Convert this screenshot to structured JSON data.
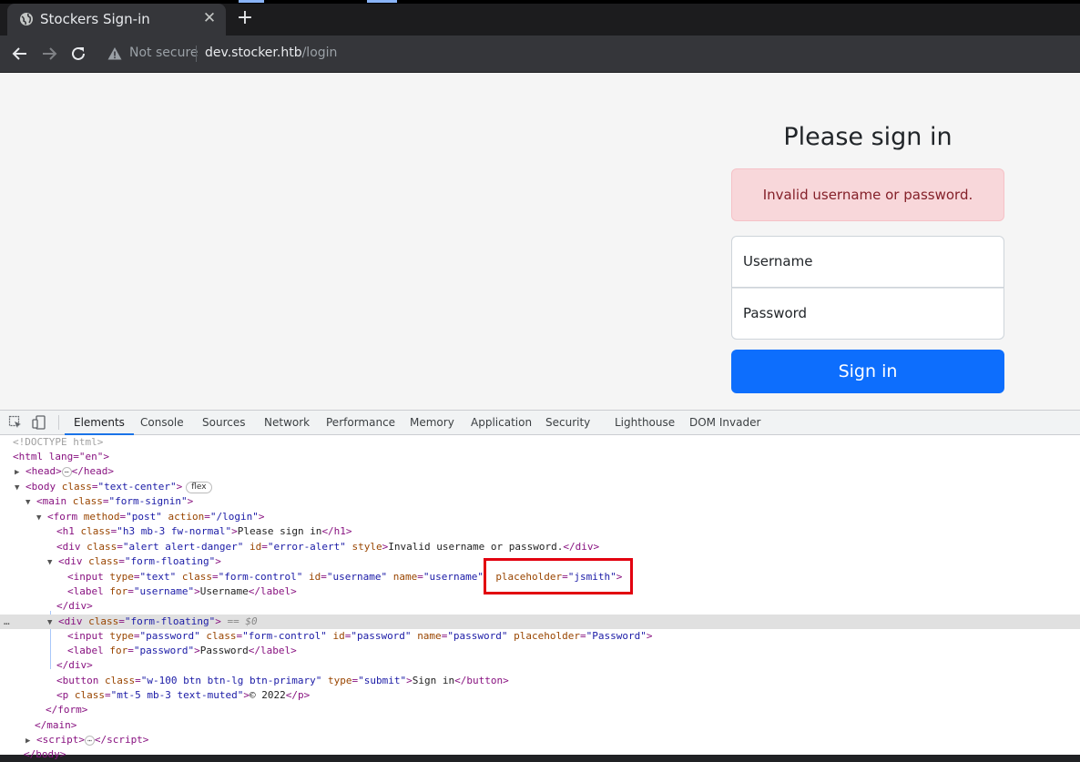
{
  "browser": {
    "tab_title": "Stockers Sign-in",
    "omnibox": {
      "security_label": "Not secure",
      "host": "dev.stocker.htb",
      "path": "/login"
    },
    "icons": [
      "globe-icon",
      "close-icon",
      "plus-icon",
      "back-arrow-icon",
      "forward-arrow-icon",
      "reload-icon",
      "warning-icon"
    ]
  },
  "page": {
    "heading": "Please sign in",
    "alert": "Invalid username or password.",
    "username_label": "Username",
    "password_label": "Password",
    "submit_label": "Sign in"
  },
  "devtools": {
    "tabs": [
      "Elements",
      "Console",
      "Sources",
      "Network",
      "Performance",
      "Memory",
      "Application",
      "Security",
      "Lighthouse",
      "DOM Invader"
    ],
    "active_tab": "Elements",
    "dom": {
      "doctype": "<!DOCTYPE html>",
      "html_open": "<html lang=\"en\">",
      "head_open": "<head>",
      "head_close": "</head>",
      "body_tag": "body",
      "body_class_attr": "class",
      "body_class_val": "\"text-center\"",
      "body_badge": "flex",
      "main_tag": "main",
      "main_class_val": "\"form-signin\"",
      "form_tag": "form",
      "form_method_val": "\"post\"",
      "form_action_val": "\"/login\"",
      "h1_tag": "h1",
      "h1_class_val": "\"h3 mb-3 fw-normal\"",
      "h1_text": "Please sign in",
      "alert_tag": "div",
      "alert_class_val": "\"alert alert-danger\"",
      "alert_id_val": "\"error-alert\"",
      "alert_style_attr": "style",
      "alert_text": "Invalid username or password.",
      "ff_class_val": "\"form-floating\"",
      "input_user_type_val": "\"text\"",
      "input_class_val": "\"form-control\"",
      "input_user_id_val": "\"username\"",
      "input_user_name_val": "\"username\"",
      "input_user_placeholder_val": "\"jsmith\"",
      "label_user_for_val": "\"username\"",
      "label_user_text": "Username",
      "selected_suffix": "== $0",
      "input_pass_type_val": "\"password\"",
      "input_pass_id_val": "\"password\"",
      "input_pass_name_val": "\"password\"",
      "input_pass_placeholder_val": "\"Password\"",
      "label_pass_for_val": "\"password\"",
      "label_pass_text": "Password",
      "button_class_val": "\"w-100 btn btn-lg btn-primary\"",
      "button_type_val": "\"submit\"",
      "button_text": "Sign in",
      "p_class_val": "\"mt-5 mb-3 text-muted\"",
      "p_text": "© 2022",
      "script_tag": "script"
    }
  },
  "colors": {
    "primary": "#0d6efd",
    "alert_bg": "#f8d7da",
    "alert_text": "#842029",
    "highlight": "#e2000f"
  }
}
